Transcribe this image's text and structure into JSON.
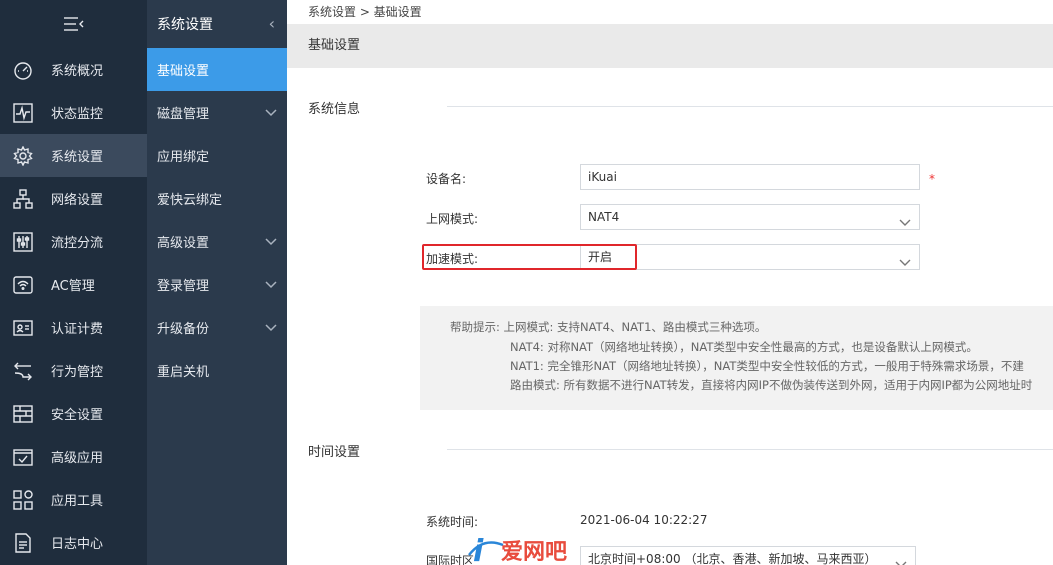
{
  "nav1": {
    "items": [
      {
        "label": "系统概况",
        "icon": "dashboard-icon"
      },
      {
        "label": "状态监控",
        "icon": "monitor-icon"
      },
      {
        "label": "系统设置",
        "icon": "gear-icon",
        "active": true
      },
      {
        "label": "网络设置",
        "icon": "network-icon"
      },
      {
        "label": "流控分流",
        "icon": "sliders-icon"
      },
      {
        "label": "AC管理",
        "icon": "wifi-icon"
      },
      {
        "label": "认证计费",
        "icon": "id-card-icon"
      },
      {
        "label": "行为管控",
        "icon": "arrows-icon"
      },
      {
        "label": "安全设置",
        "icon": "firewall-icon"
      },
      {
        "label": "高级应用",
        "icon": "check-box-icon"
      },
      {
        "label": "应用工具",
        "icon": "grid-icon"
      },
      {
        "label": "日志中心",
        "icon": "document-icon"
      }
    ]
  },
  "nav2": {
    "title": "系统设置",
    "items": [
      {
        "label": "基础设置",
        "active": true,
        "expandable": false
      },
      {
        "label": "磁盘管理",
        "expandable": true
      },
      {
        "label": "应用绑定",
        "expandable": false
      },
      {
        "label": "爱快云绑定",
        "expandable": false
      },
      {
        "label": "高级设置",
        "expandable": true
      },
      {
        "label": "登录管理",
        "expandable": true
      },
      {
        "label": "升级备份",
        "expandable": true
      },
      {
        "label": "重启关机",
        "expandable": false
      }
    ]
  },
  "main": {
    "breadcrumb": "系统设置 > 基础设置",
    "page_title": "基础设置",
    "section_system": "系统信息",
    "device_name_label": "设备名:",
    "device_name_value": "iKuai",
    "required_mark": "*",
    "wan_mode_label": "上网模式:",
    "wan_mode_value": "NAT4",
    "accel_mode_label": "加速模式:",
    "accel_mode_value": "开启",
    "help_lines": [
      "帮助提示: 上网模式: 支持NAT4、NAT1、路由模式三种选项。",
      "NAT4: 对称NAT（网络地址转换），NAT类型中安全性最高的方式，也是设备默认上网模式。",
      "NAT1: 完全锥形NAT（网络地址转换），NAT类型中安全性较低的方式，一般用于特殊需求场景，不建",
      "路由模式: 所有数据不进行NAT转发，直接将内网IP不做伪装传送到外网，适用于内网IP都为公网地址时"
    ],
    "section_time": "时间设置",
    "sys_time_label": "系统时间:",
    "sys_time_value": "2021-06-04 10:22:27",
    "timezone_label": "国际时区",
    "timezone_value": "北京时间+08:00 （北京、香港、新加坡、马来西亚）"
  },
  "watermark": "爱网吧",
  "colors": {
    "nav1_bg": "#1f2d3d",
    "nav2_bg": "#2b3a4c",
    "accent": "#3c9be8",
    "highlight": "#e0262b"
  }
}
